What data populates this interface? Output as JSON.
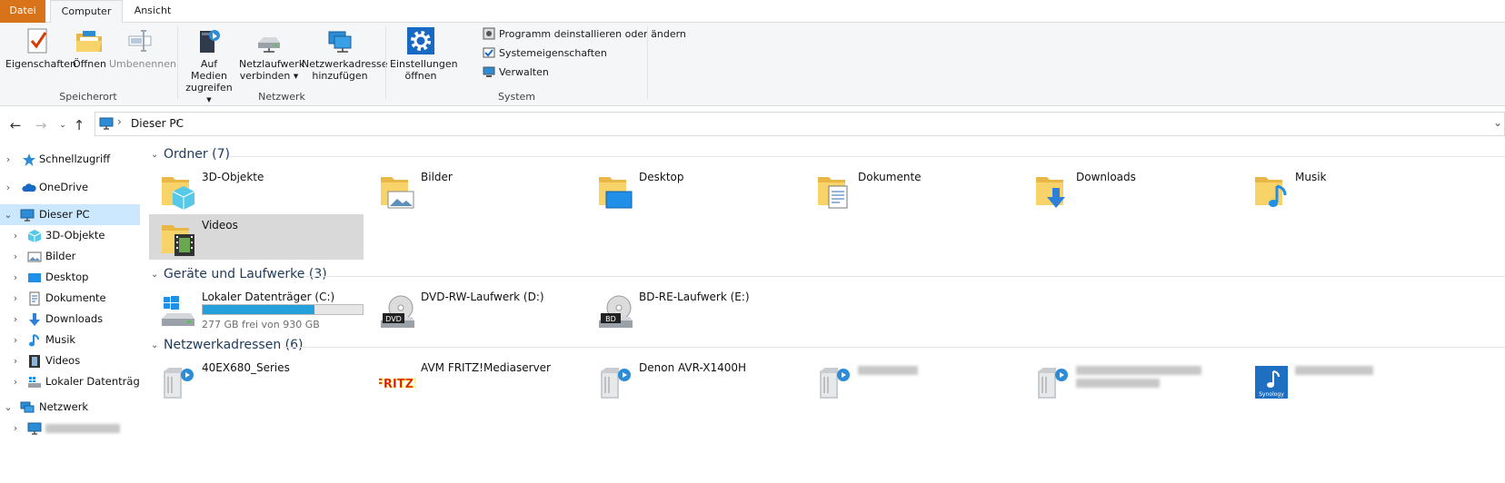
{
  "ribbon_tabs": [
    "Datei",
    "Computer",
    "Ansicht"
  ],
  "ribbon": {
    "speicherort": {
      "label": "Speicherort",
      "buttons": [
        "Eigenschaften",
        "Öffnen",
        "Umbenennen"
      ]
    },
    "netzwerk": {
      "label": "Netzwerk",
      "media_line1": "Auf Medien",
      "media_line2": "zugreifen",
      "netdrive_line1": "Netzlaufwerk",
      "netdrive_line2": "verbinden",
      "netaddr_line1": "Netzwerkadresse",
      "netaddr_line2": "hinzufügen"
    },
    "system": {
      "label": "System",
      "settings_line1": "Einstellungen",
      "settings_line2": "öffnen",
      "small_buttons": [
        "Programm deinstallieren oder ändern",
        "Systemeigenschaften",
        "Verwalten"
      ]
    }
  },
  "address": {
    "path": "Dieser PC",
    "separator": "›"
  },
  "sidebar": {
    "items": [
      {
        "label": "Schnellzugriff",
        "icon": "star-icon"
      },
      {
        "label": "OneDrive",
        "icon": "cloud-icon"
      },
      {
        "label": "Dieser PC",
        "icon": "computer-icon"
      },
      {
        "label": "3D-Objekte",
        "icon": "cube-icon"
      },
      {
        "label": "Bilder",
        "icon": "pictures-icon"
      },
      {
        "label": "Desktop",
        "icon": "desktop-icon"
      },
      {
        "label": "Dokumente",
        "icon": "documents-icon"
      },
      {
        "label": "Downloads",
        "icon": "download-icon"
      },
      {
        "label": "Musik",
        "icon": "music-icon"
      },
      {
        "label": "Videos",
        "icon": "video-icon"
      },
      {
        "label": "Lokaler Datenträger",
        "icon": "drive-icon"
      },
      {
        "label": "Netzwerk",
        "icon": "network-icon"
      }
    ]
  },
  "groups": {
    "ordner": "Ordner (7)",
    "geraete": "Geräte und Laufwerke (3)",
    "netzwerk": "Netzwerkadressen (6)"
  },
  "folders": [
    "3D-Objekte",
    "Bilder",
    "Desktop",
    "Dokumente",
    "Downloads",
    "Musik",
    "Videos"
  ],
  "drives": [
    {
      "name": "Lokaler Datenträger (C:)",
      "free": "277 GB frei von 930 GB",
      "used_fraction": 0.7
    },
    {
      "name": "DVD-RW-Laufwerk (D:)",
      "badge": "DVD"
    },
    {
      "name": "BD-RE-Laufwerk (E:)",
      "badge": "BD"
    }
  ],
  "network_locations": [
    {
      "name": "40EX680_Series"
    },
    {
      "name": "AVM FRITZ!Mediaserver",
      "logo": "FRITZ!"
    },
    {
      "name": "Denon AVR-X1400H"
    },
    {
      "name": ""
    },
    {
      "name": ""
    },
    {
      "name": "",
      "logo": "Synology"
    }
  ],
  "colors": {
    "file_tab": "#d8731a",
    "selection": "#cce8ff",
    "drive_bar": "#26a0da",
    "group_title": "#1e395b"
  }
}
